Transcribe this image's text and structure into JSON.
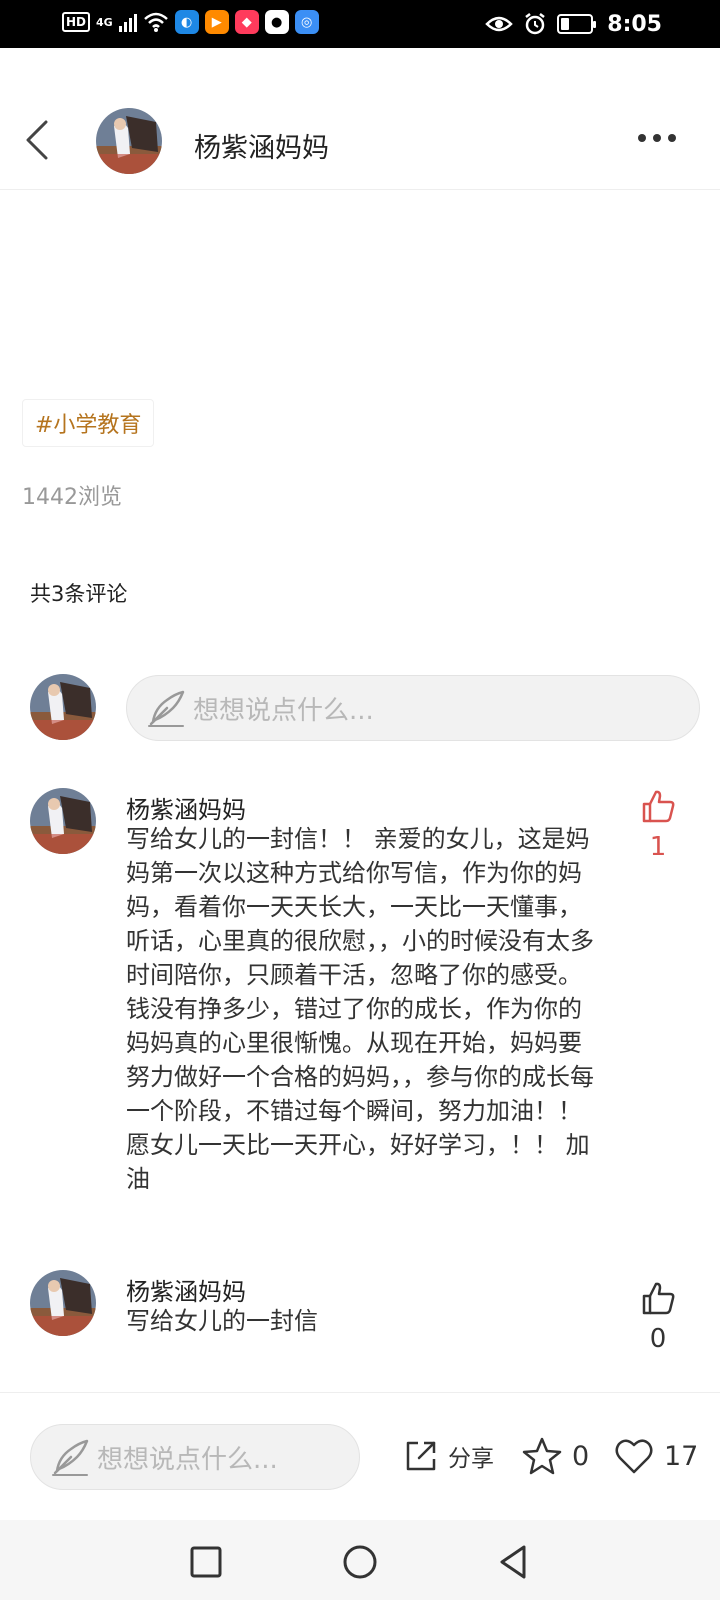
{
  "status_bar": {
    "hd": "HD",
    "network": "4G",
    "time": "8:05"
  },
  "header": {
    "title": "杨紫涵妈妈"
  },
  "post": {
    "tag": "#小学教育",
    "views": "1442浏览"
  },
  "comments_section": {
    "count_label": "共3条评论",
    "input_placeholder": "想想说点什么..."
  },
  "comments": [
    {
      "author": "杨紫涵妈妈",
      "text": "写给女儿的一封信！！ 亲爱的女儿，这是妈妈第一次以这种方式给你写信，作为你的妈妈，看着你一天天长大，一天比一天懂事，听话，心里真的很欣慰，，小的时候没有太多时间陪你，只顾着干活，忽略了你的感受。钱没有挣多少，错过了你的成长，作为你的妈妈真的心里很惭愧。从现在开始，妈妈要努力做好一个合格的妈妈，，参与你的成长每一个阶段，不错过每个瞬间，努力加油！！ 愿女儿一天比一天开心，好好学习，！！ 加油",
      "likes": "1",
      "liked": true
    },
    {
      "author": "杨紫涵妈妈",
      "text": "写给女儿的一封信",
      "likes": "0",
      "liked": false
    }
  ],
  "bottom_bar": {
    "input_placeholder": "想想说点什么...",
    "share_label": "分享",
    "favorites": "0",
    "likes": "17"
  },
  "colors": {
    "accent": "#d9534f",
    "tag": "#b5741e"
  }
}
